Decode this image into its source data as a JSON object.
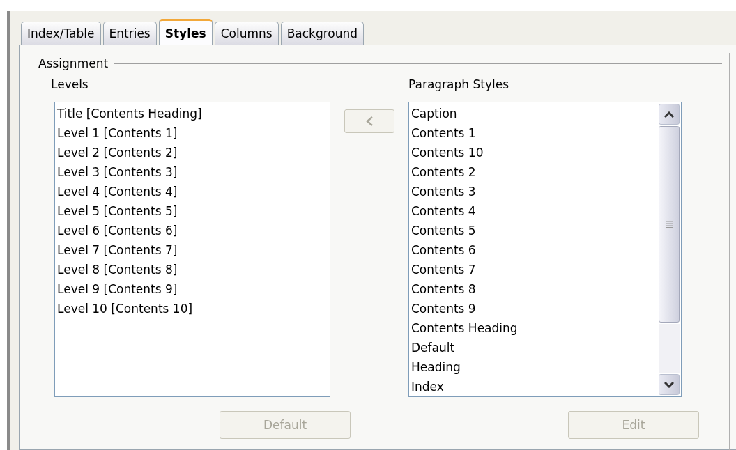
{
  "tabs": [
    {
      "label": "Index/Table",
      "selected": false
    },
    {
      "label": "Entries",
      "selected": false
    },
    {
      "label": "Styles",
      "selected": true
    },
    {
      "label": "Columns",
      "selected": false
    },
    {
      "label": "Background",
      "selected": false
    }
  ],
  "assignment": {
    "title": "Assignment",
    "levels": {
      "label": "Levels",
      "items": [
        "Title [Contents Heading]",
        "Level 1 [Contents 1]",
        "Level 2 [Contents 2]",
        "Level 3 [Contents 3]",
        "Level 4 [Contents 4]",
        "Level 5 [Contents 5]",
        "Level 6 [Contents 6]",
        "Level 7 [Contents 7]",
        "Level 8 [Contents 8]",
        "Level 9 [Contents 9]",
        "Level 10 [Contents 10]"
      ]
    },
    "assign_button": {
      "disabled": true
    },
    "paragraph_styles": {
      "label": "Paragraph Styles",
      "items": [
        "Caption",
        "Contents 1",
        "Contents 10",
        "Contents 2",
        "Contents 3",
        "Contents 4",
        "Contents 5",
        "Contents 6",
        "Contents 7",
        "Contents 8",
        "Contents 9",
        "Contents Heading",
        "Default",
        "Heading",
        "Index"
      ]
    },
    "buttons": [
      {
        "label": "Default",
        "disabled": true
      },
      {
        "label": "Edit",
        "disabled": true
      }
    ]
  }
}
